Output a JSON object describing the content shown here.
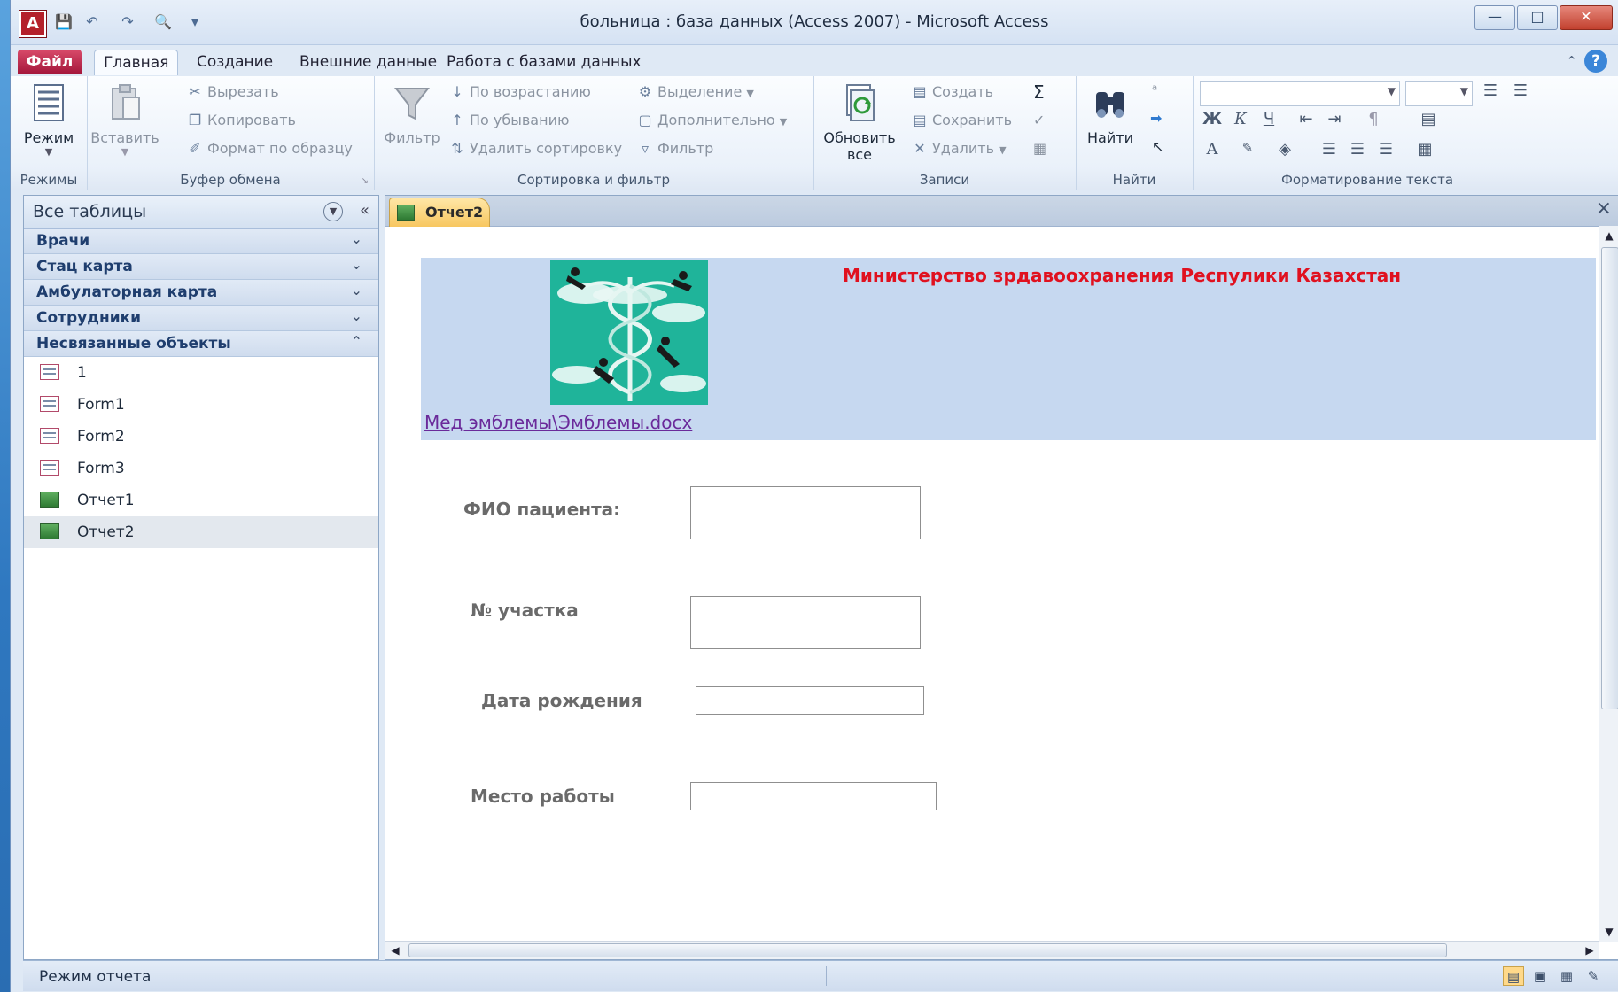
{
  "window": {
    "title": "больница : база данных (Access 2007)  -  Microsoft Access",
    "app_icon_letter": "A"
  },
  "ribbon_tabs": [
    "Файл",
    "Главная",
    "Создание",
    "Внешние данные",
    "Работа с базами данных"
  ],
  "ribbon": {
    "views": {
      "view_label": "Режим",
      "group_label": "Режимы"
    },
    "clipboard": {
      "paste_label": "Вставить",
      "cut_label": "Вырезать",
      "copy_label": "Копировать",
      "format_painter_label": "Формат по образцу",
      "group_label": "Буфер обмена"
    },
    "sort_filter": {
      "filter_label": "Фильтр",
      "ascending_label": "По возрастанию",
      "descending_label": "По убыванию",
      "remove_sort_label": "Удалить сортировку",
      "selection_label": "Выделение",
      "advanced_label": "Дополнительно",
      "toggle_filter_label": "Фильтр",
      "group_label": "Сортировка и фильтр"
    },
    "records": {
      "refresh_label_1": "Обновить",
      "refresh_label_2": "все",
      "new_label": "Создать",
      "save_label": "Сохранить",
      "delete_label": "Удалить",
      "group_label": "Записи"
    },
    "find": {
      "find_label": "Найти",
      "group_label": "Найти"
    },
    "text_format": {
      "bold": "Ж",
      "italic": "К",
      "underline": "Ч",
      "font_color": "A",
      "group_label": "Форматирование текста"
    }
  },
  "nav_pane": {
    "title": "Все таблицы",
    "groups": [
      {
        "label": "Врачи"
      },
      {
        "label": "Стац карта"
      },
      {
        "label": "Амбулаторная карта"
      },
      {
        "label": "Сотрудники"
      },
      {
        "label": "Несвязанные объекты"
      }
    ],
    "items": [
      {
        "label": "1",
        "type": "form"
      },
      {
        "label": "Form1",
        "type": "form"
      },
      {
        "label": "Form2",
        "type": "form"
      },
      {
        "label": "Form3",
        "type": "form"
      },
      {
        "label": "Отчет1",
        "type": "report"
      },
      {
        "label": "Отчет2",
        "type": "report"
      }
    ]
  },
  "document": {
    "tab_label": "Отчет2",
    "ministry_title": "Министерство зрдавоохранения Респулики Казахстан",
    "emblem_link": "Мед эмблемы\\Эмблемы.docx",
    "fields": [
      {
        "label": "ФИО пациента:"
      },
      {
        "label": "№ участка"
      },
      {
        "label": "Дата рождения"
      },
      {
        "label": "Место работы"
      }
    ]
  },
  "status": {
    "text": "Режим отчета"
  },
  "colors": {
    "file_tab": "#c0224a",
    "ministry_text": "#e0111f",
    "header_band": "#c6d8f0",
    "link": "#6a2a9a",
    "emblem_bg": "#1fb49a"
  }
}
